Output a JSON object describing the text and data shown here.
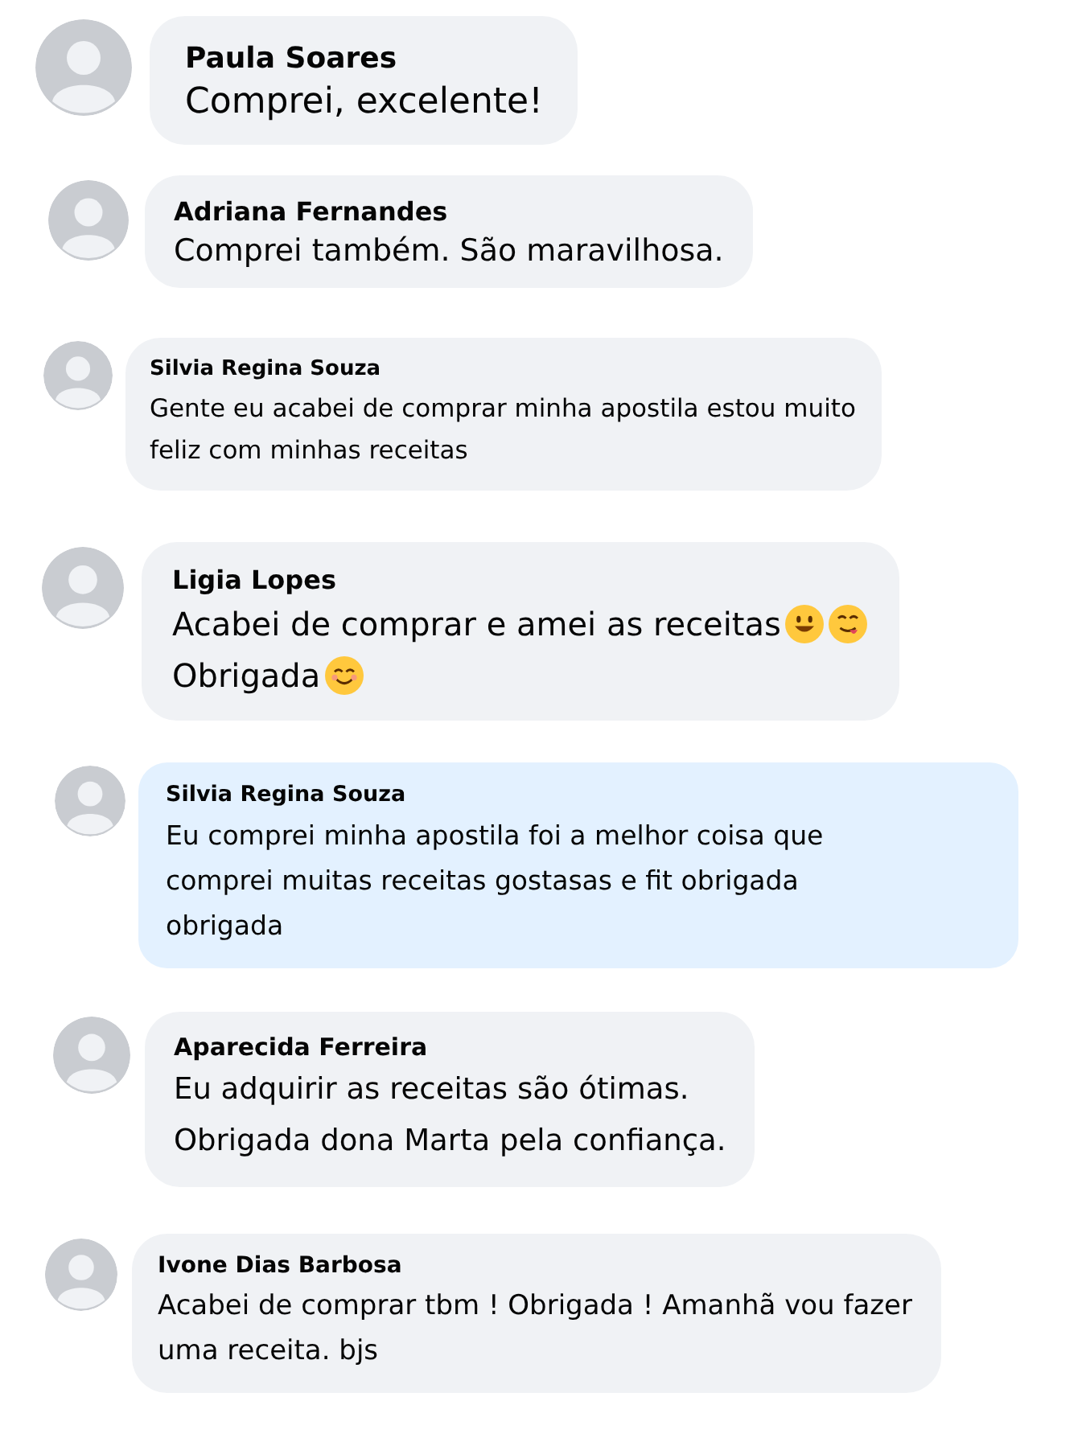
{
  "comments": [
    {
      "author": "Paula Soares",
      "highlighted": false,
      "lines": [
        [
          {
            "kind": "text",
            "text": "Comprei, excelente!"
          }
        ]
      ]
    },
    {
      "author": "Adriana Fernandes",
      "highlighted": false,
      "lines": [
        [
          {
            "kind": "text",
            "text": "Comprei também. São maravilhosa."
          }
        ]
      ]
    },
    {
      "author": "Silvia Regina Souza",
      "highlighted": false,
      "lines": [
        [
          {
            "kind": "text",
            "text": "Gente eu acabei de comprar minha apostila estou muito"
          }
        ],
        [
          {
            "kind": "text",
            "text": "feliz com minhas receitas"
          }
        ]
      ]
    },
    {
      "author": "Ligia Lopes",
      "highlighted": false,
      "lines": [
        [
          {
            "kind": "text",
            "text": "Acabei de comprar e amei as receitas"
          },
          {
            "kind": "grin"
          },
          {
            "kind": "yum"
          }
        ],
        [
          {
            "kind": "text",
            "text": "Obrigada"
          },
          {
            "kind": "smile"
          }
        ]
      ]
    },
    {
      "author": "Silvia Regina Souza",
      "highlighted": true,
      "lines": [
        [
          {
            "kind": "text",
            "text": "Eu comprei minha apostila foi a melhor coisa que"
          }
        ],
        [
          {
            "kind": "text",
            "text": "comprei muitas receitas gostasas e fit obrigada"
          }
        ],
        [
          {
            "kind": "text",
            "text": "obrigada"
          }
        ]
      ]
    },
    {
      "author": "Aparecida Ferreira",
      "highlighted": false,
      "lines": [
        [
          {
            "kind": "text",
            "text": "Eu adquirir as receitas são ótimas."
          }
        ],
        [
          {
            "kind": "text",
            "text": "Obrigada dona Marta pela confiança."
          }
        ]
      ]
    },
    {
      "author": "Ivone Dias Barbosa",
      "highlighted": false,
      "lines": [
        [
          {
            "kind": "text",
            "text": "Acabei de comprar tbm ! Obrigada ! Amanhã vou fazer"
          }
        ],
        [
          {
            "kind": "text",
            "text": "uma receita. bjs"
          }
        ]
      ]
    }
  ]
}
